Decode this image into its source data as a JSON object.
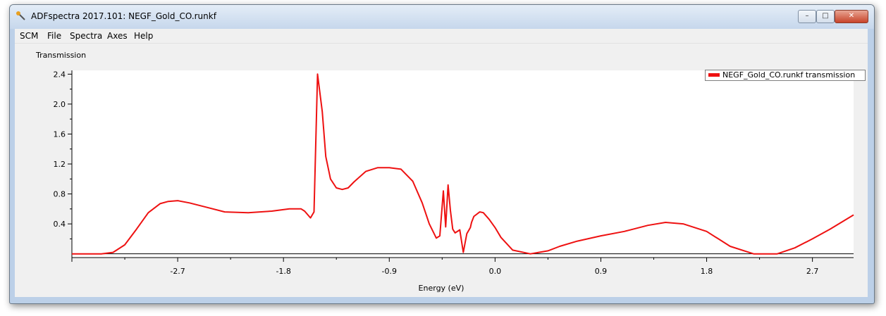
{
  "window": {
    "title": "ADFspectra 2017.101: NEGF_Gold_CO.runkf",
    "minimize": "–",
    "maximize": "□",
    "close": "✕"
  },
  "menu": [
    "SCM",
    "File",
    "Spectra",
    "Axes",
    "Help"
  ],
  "colors": {
    "series": "#ee1111",
    "plot_background": "#ffffff",
    "panel_background": "#f0f0f0"
  },
  "chart_data": {
    "type": "line",
    "ylabel": "Transmission",
    "xlabel": "Energy (eV)",
    "xlim": [
      -3.6,
      3.05
    ],
    "ylim": [
      -0.05,
      2.45
    ],
    "x_ticks": [
      -2.7,
      -1.8,
      -0.9,
      0.0,
      0.9,
      1.8,
      2.7
    ],
    "x_tick_labels": [
      "-2.7",
      "-1.8",
      "-0.9",
      "0.0",
      "0.9",
      "1.8",
      "2.7"
    ],
    "y_ticks": [
      0.4,
      0.8,
      1.2,
      1.6,
      2.0,
      2.4
    ],
    "y_tick_labels": [
      "0.4",
      "0.8",
      "1.2",
      "1.6",
      "2.0",
      "2.4"
    ],
    "grid": false,
    "legend_position": "top-right",
    "series": [
      {
        "name": "NEGF_Gold_CO.runkf transmission",
        "x": [
          -3.6,
          -3.35,
          -3.25,
          -3.15,
          -3.05,
          -2.95,
          -2.85,
          -2.78,
          -2.7,
          -2.6,
          -2.45,
          -2.3,
          -2.1,
          -1.9,
          -1.75,
          -1.65,
          -1.62,
          -1.57,
          -1.54,
          -1.51,
          -1.47,
          -1.44,
          -1.4,
          -1.35,
          -1.3,
          -1.25,
          -1.2,
          -1.1,
          -1.0,
          -0.9,
          -0.8,
          -0.7,
          -0.62,
          -0.56,
          -0.5,
          -0.47,
          -0.44,
          -0.42,
          -0.4,
          -0.38,
          -0.36,
          -0.34,
          -0.3,
          -0.27,
          -0.24,
          -0.21,
          -0.2,
          -0.18,
          -0.13,
          -0.1,
          -0.05,
          0.0,
          0.05,
          0.15,
          0.3,
          0.45,
          0.55,
          0.7,
          0.9,
          1.1,
          1.3,
          1.45,
          1.6,
          1.8,
          2.0,
          2.2,
          2.4,
          2.55,
          2.7,
          2.85,
          3.05
        ],
        "y": [
          0.0,
          0.0,
          0.02,
          0.12,
          0.33,
          0.55,
          0.67,
          0.7,
          0.71,
          0.68,
          0.62,
          0.56,
          0.55,
          0.57,
          0.6,
          0.6,
          0.57,
          0.48,
          0.56,
          2.4,
          1.9,
          1.3,
          1.0,
          0.88,
          0.86,
          0.88,
          0.96,
          1.1,
          1.15,
          1.15,
          1.13,
          0.97,
          0.68,
          0.4,
          0.21,
          0.24,
          0.84,
          0.36,
          0.92,
          0.58,
          0.33,
          0.28,
          0.32,
          0.02,
          0.27,
          0.35,
          0.42,
          0.5,
          0.56,
          0.55,
          0.46,
          0.35,
          0.22,
          0.05,
          0.0,
          0.04,
          0.1,
          0.17,
          0.24,
          0.3,
          0.38,
          0.42,
          0.4,
          0.3,
          0.1,
          0.0,
          0.0,
          0.08,
          0.2,
          0.33,
          0.52
        ]
      }
    ]
  }
}
